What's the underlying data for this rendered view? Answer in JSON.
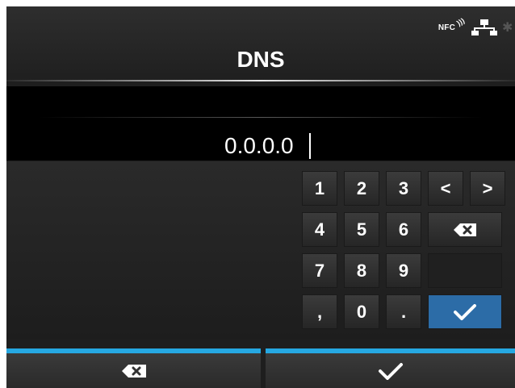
{
  "header": {
    "nfc_label": "NFC",
    "title": "DNS"
  },
  "input": {
    "value": "0.0.0.0"
  },
  "keypad": {
    "rows": [
      [
        "1",
        "2",
        "3"
      ],
      [
        "4",
        "5",
        "6"
      ],
      [
        "7",
        "8",
        "9"
      ],
      [
        ",",
        "0",
        "."
      ]
    ],
    "left_arrow": "<",
    "right_arrow": ">"
  },
  "bottom": {
    "backspace_icon": "backspace-icon",
    "confirm_icon": "checkmark-icon"
  },
  "colors": {
    "accent": "#26a8e2",
    "enter_key": "#2c6ca7"
  }
}
